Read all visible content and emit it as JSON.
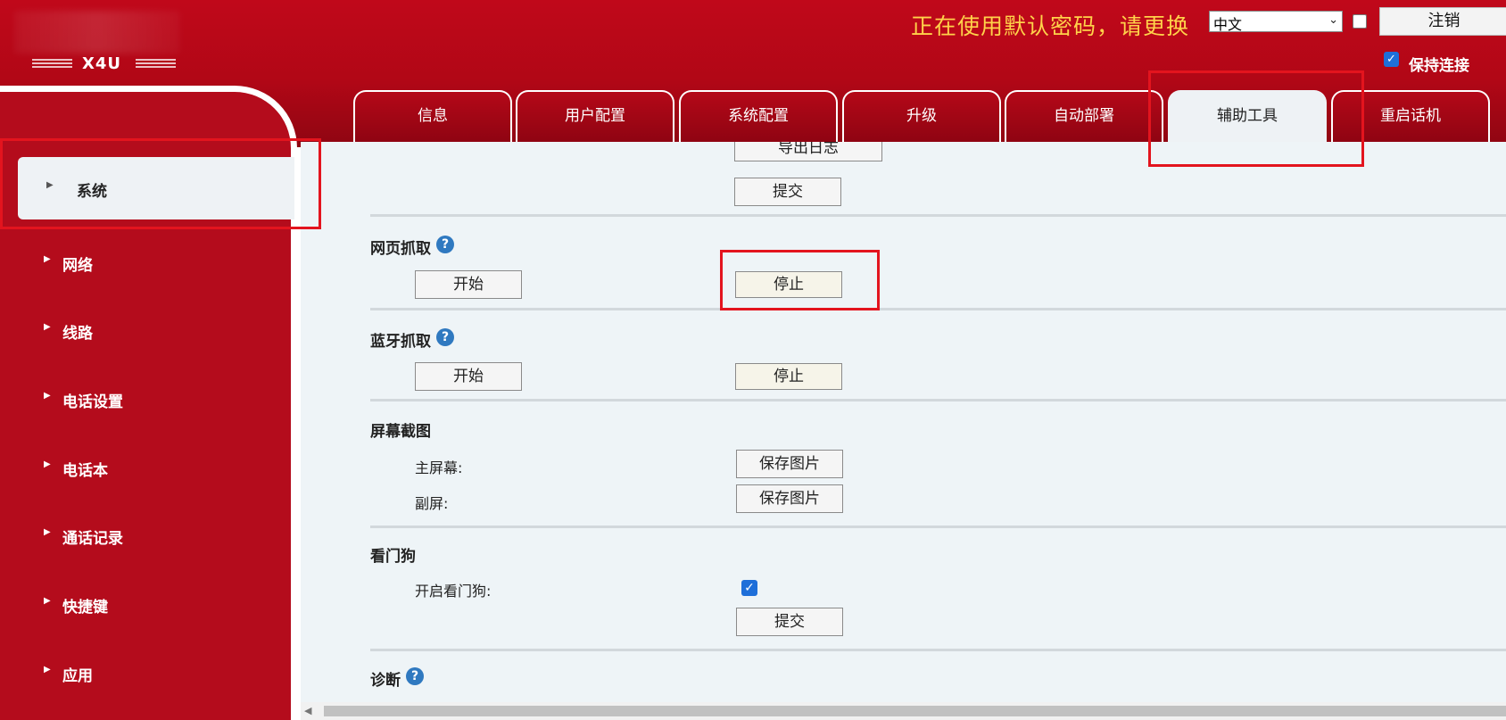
{
  "header": {
    "model": "X4U",
    "warning": "正在使用默认密码，请更换",
    "language": "中文",
    "logout_label": "注销",
    "keep_connected_label": "保持连接"
  },
  "tabs": [
    {
      "label": "信息"
    },
    {
      "label": "用户配置"
    },
    {
      "label": "系统配置"
    },
    {
      "label": "升级"
    },
    {
      "label": "自动部署"
    },
    {
      "label": "辅助工具",
      "active": true
    },
    {
      "label": "重启话机"
    }
  ],
  "sidebar": {
    "items": [
      {
        "label": "系统",
        "active": true
      },
      {
        "label": "网络"
      },
      {
        "label": "线路"
      },
      {
        "label": "电话设置"
      },
      {
        "label": "电话本"
      },
      {
        "label": "通话记录"
      },
      {
        "label": "快捷键"
      },
      {
        "label": "应用"
      }
    ]
  },
  "log": {
    "export_label": "导出日志",
    "submit_label": "提交"
  },
  "web_capture": {
    "title": "网页抓取",
    "start_label": "开始",
    "stop_label": "停止"
  },
  "bt_capture": {
    "title": "蓝牙抓取",
    "start_label": "开始",
    "stop_label": "停止"
  },
  "screenshot": {
    "title": "屏幕截图",
    "main_label": "主屏幕:",
    "sub_label": "副屏:",
    "save_label": "保存图片"
  },
  "watchdog": {
    "title": "看门狗",
    "enable_label": "开启看门狗:",
    "enabled": true,
    "submit_label": "提交"
  },
  "diagnostics": {
    "title": "诊断"
  },
  "colors": {
    "brand_red": "#b40c1c",
    "warning_yellow": "#ffd24a",
    "highlight_red": "#e3141e",
    "content_bg": "#eef4f7"
  }
}
